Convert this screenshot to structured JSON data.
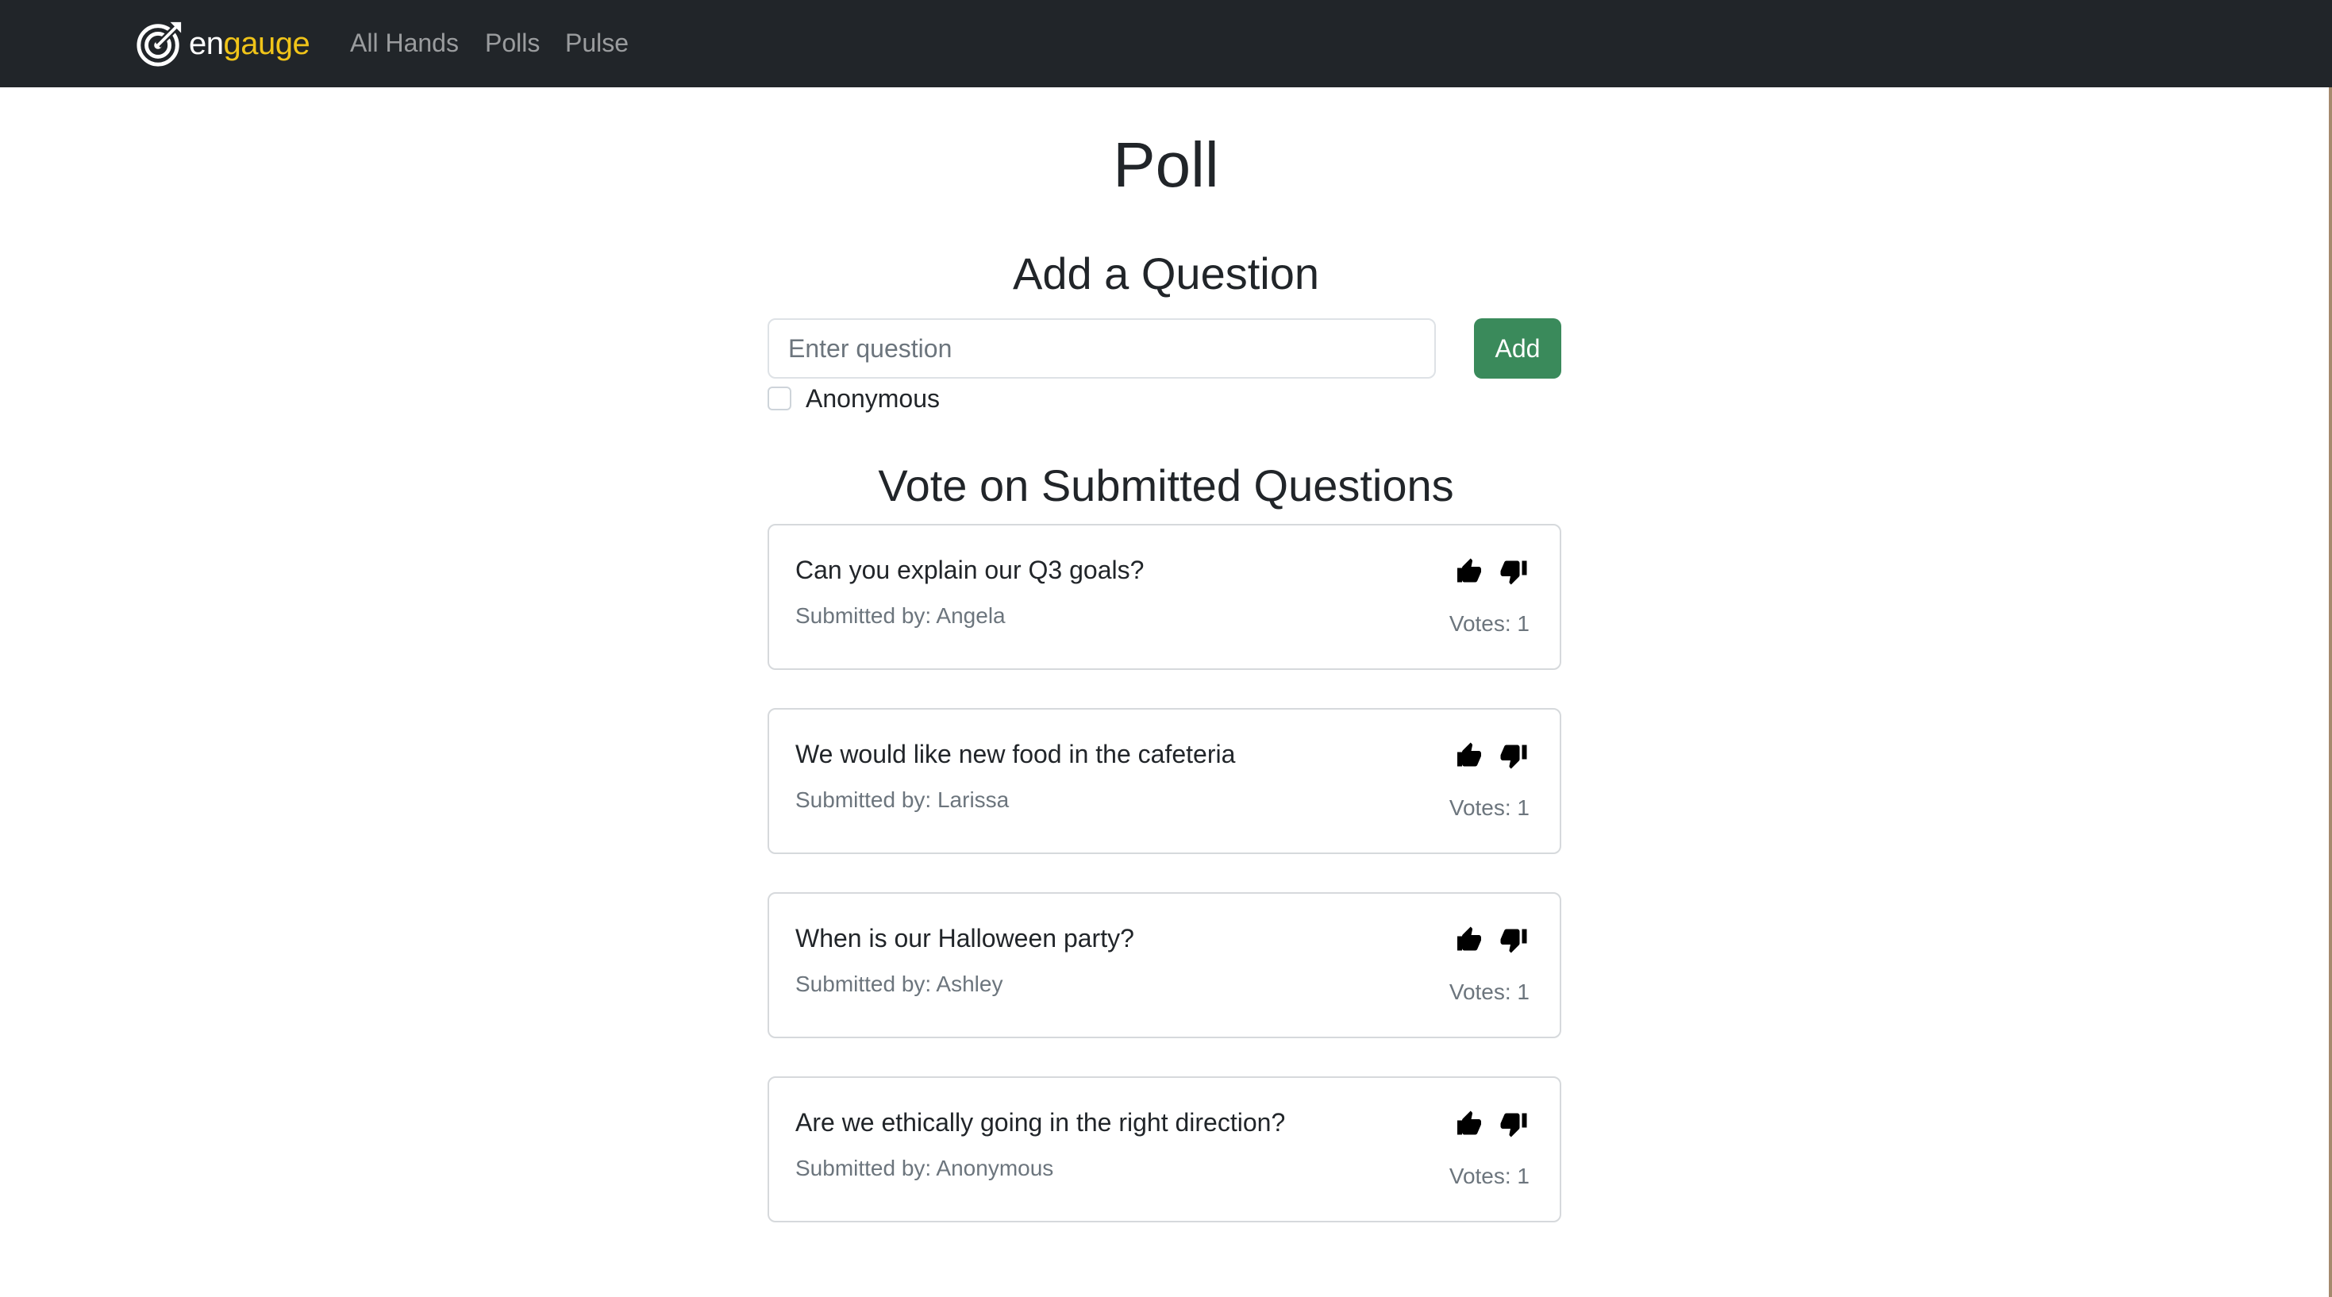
{
  "navbar": {
    "brand_part1": "en",
    "brand_part2": "gauge",
    "brand_accent_color": "#f0c419",
    "background_color": "#212529",
    "links": [
      {
        "label": "All Hands"
      },
      {
        "label": "Polls"
      },
      {
        "label": "Pulse"
      }
    ]
  },
  "page": {
    "title": "Poll"
  },
  "add_question": {
    "heading": "Add a Question",
    "input_placeholder": "Enter question",
    "input_value": "",
    "add_label": "Add",
    "add_color": "#3a8a5b",
    "anonymous_label": "Anonymous",
    "anonymous_checked": false
  },
  "vote": {
    "heading": "Vote on Submitted Questions",
    "questions": [
      {
        "text": "Can you explain our Q3 goals?",
        "submitted_by": "Submitted by: Angela",
        "votes": "Votes: 1"
      },
      {
        "text": "We would like new food in the cafeteria",
        "submitted_by": "Submitted by: Larissa",
        "votes": "Votes: 1"
      },
      {
        "text": "When is our Halloween party?",
        "submitted_by": "Submitted by: Ashley",
        "votes": "Votes: 1"
      },
      {
        "text": "Are we ethically going in the right direction?",
        "submitted_by": "Submitted by: Anonymous",
        "votes": "Votes: 1"
      }
    ]
  },
  "icons": {
    "logo": "target-arrow-icon",
    "upvote": "thumbs-up-icon",
    "downvote": "thumbs-down-icon"
  }
}
